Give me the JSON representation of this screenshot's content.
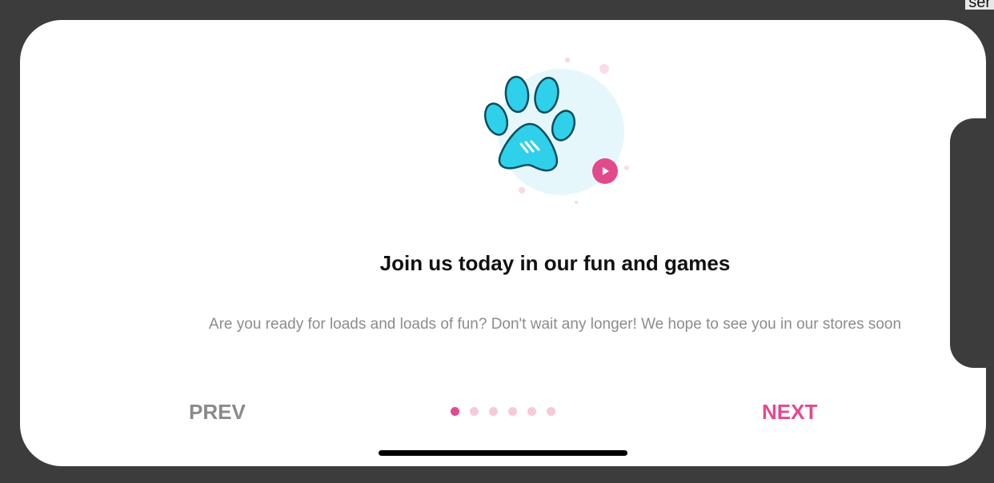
{
  "background": {
    "corner_text": "ser"
  },
  "onboarding": {
    "title": "Join us today in our fun and games",
    "subtitle": "Are you ready for loads and loads of fun? Don't wait any longer! We hope to see you in our stores soon",
    "prev_label": "PREV",
    "next_label": "NEXT",
    "page_count": 6,
    "active_page": 1,
    "illustration_icon": "paw-icon",
    "play_icon": "play-icon"
  },
  "colors": {
    "accent": "#e24a8d",
    "paw": "#2fd0ea",
    "paw_outline": "#0b4d5f",
    "dot_inactive": "#f6c9dd",
    "circle_bg": "#e6f7fb"
  }
}
